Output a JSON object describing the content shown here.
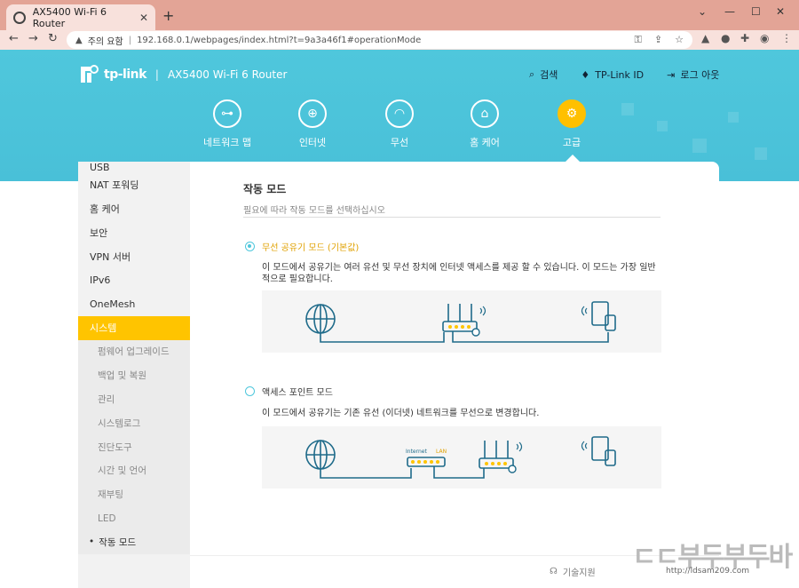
{
  "browser": {
    "tab_title": "AX5400 Wi-Fi 6 Router",
    "url_warning": "주의 요함",
    "url": "192.168.0.1/webpages/index.html?t=9a3a46f1#operationMode"
  },
  "header": {
    "brand": "tp-link",
    "model": "AX5400 Wi-Fi 6 Router",
    "links": [
      {
        "label": "검색",
        "icon": "search-icon"
      },
      {
        "label": "TP-Link ID",
        "icon": "user-icon"
      },
      {
        "label": "로그 아웃",
        "icon": "logout-icon"
      }
    ]
  },
  "nav": {
    "items": [
      {
        "label": "네트워크 맵",
        "icon": "network-map-icon"
      },
      {
        "label": "인터넷",
        "icon": "globe-icon"
      },
      {
        "label": "무선",
        "icon": "wifi-icon"
      },
      {
        "label": "홈 케어",
        "icon": "home-care-icon"
      },
      {
        "label": "고급",
        "icon": "gear-icon",
        "active": true
      }
    ]
  },
  "sidebar": {
    "items": [
      "USB",
      "NAT 포워딩",
      "홈 케어",
      "보안",
      "VPN 서버",
      "IPv6",
      "OneMesh",
      "시스템"
    ],
    "active": "시스템",
    "subitems": [
      "펌웨어 업그레이드",
      "백업 및 복원",
      "관리",
      "시스템로그",
      "진단도구",
      "시간 및 언어",
      "재부팅",
      "LED",
      "작동 모드"
    ],
    "current_sub": "작동 모드"
  },
  "page": {
    "title": "작동 모드",
    "subtitle": "필요에 따라 작동 모드를 선택하십시오",
    "options": [
      {
        "label": "무선 공유기 모드 (기본값)",
        "selected": true,
        "description": "이 모드에서 공유기는 여러 유선 및 무선 장치에 인터넷 액세스를 제공 할 수 있습니다. 이 모드는 가장 일반적으로 필요합니다."
      },
      {
        "label": "액세스 포인트 모드",
        "selected": false,
        "description": "이 모드에서 공유기는 기존 유선 (이더넷) 네트워크를 무선으로 변경합니다."
      }
    ],
    "diagram_labels": {
      "internet": "Internet",
      "lan": "LAN"
    }
  },
  "footer": {
    "support": "기술지원"
  },
  "watermark": {
    "big": "ㄷㄷ부두부두바",
    "small": "http://ldsam209.com"
  },
  "colors": {
    "header": "#4fc7dc",
    "accent": "#ffc400",
    "active_label": "#e0a100"
  }
}
